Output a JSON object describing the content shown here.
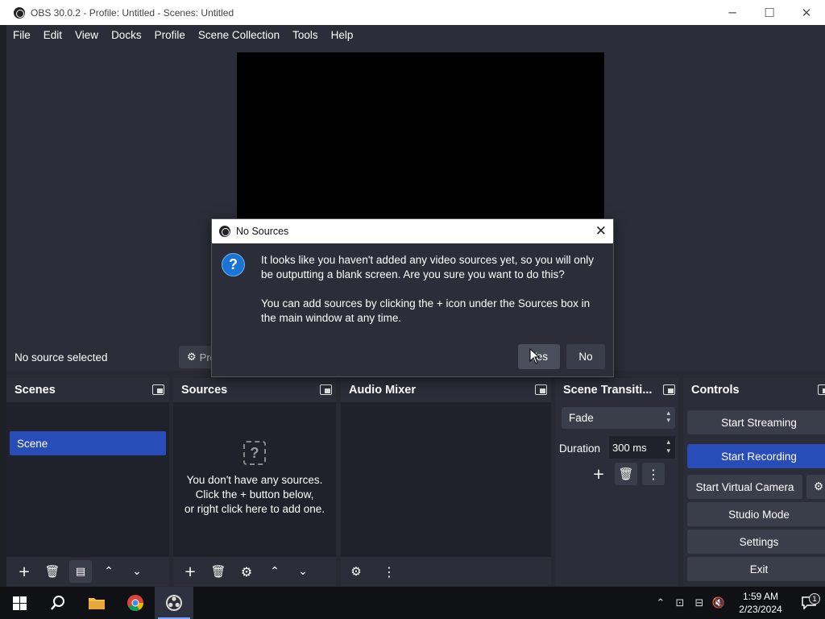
{
  "window": {
    "title": "OBS 30.0.2 - Profile: Untitled - Scenes: Untitled",
    "minimize": "─",
    "maximize": "☐",
    "close": "✕"
  },
  "menu": [
    "File",
    "Edit",
    "View",
    "Docks",
    "Profile",
    "Scene Collection",
    "Tools",
    "Help"
  ],
  "source_bar": {
    "status": "No source selected",
    "properties_label": "Properties"
  },
  "docks": {
    "scenes": {
      "title": "Scenes",
      "items": [
        "Scene"
      ]
    },
    "sources": {
      "title": "Sources",
      "empty_line1": "You don't have any sources.",
      "empty_line2": "Click the + button below,",
      "empty_line3": "or right click here to add one."
    },
    "audio": {
      "title": "Audio Mixer"
    },
    "transitions": {
      "title": "Scene Transiti...",
      "selected": "Fade",
      "duration_label": "Duration",
      "duration_value": "300 ms"
    },
    "controls": {
      "title": "Controls",
      "start_streaming": "Start Streaming",
      "start_recording": "Start Recording",
      "start_virtual_camera": "Start Virtual Camera",
      "studio_mode": "Studio Mode",
      "settings": "Settings",
      "exit": "Exit"
    }
  },
  "dialog": {
    "title": "No Sources",
    "message1": "It looks like you haven't added any video sources yet, so you will only be outputting a blank screen. Are you sure you want to do this?",
    "message2": "You can add sources by clicking the + icon under the Sources box in the main window at any time.",
    "yes": "Yes",
    "no": "No"
  },
  "taskbar": {
    "time": "1:59 AM",
    "date": "2/23/2024",
    "notification_count": "1"
  },
  "colors": {
    "accent": "#284cb8",
    "panel": "#2b2e38",
    "panel_dark": "#1f222b"
  }
}
